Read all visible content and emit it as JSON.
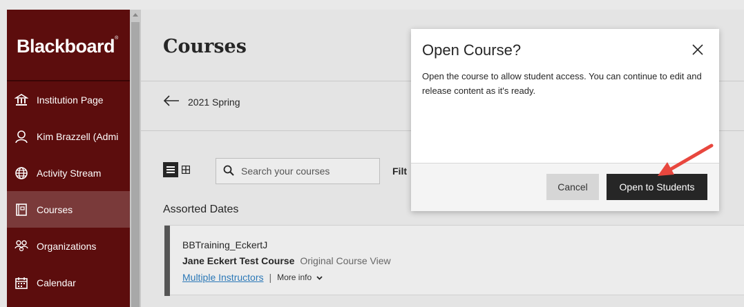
{
  "sidebar": {
    "logo": "Blackboard",
    "items": [
      {
        "label": "Institution Page",
        "icon": "bank-icon"
      },
      {
        "label": "Kim Brazzell (Admi",
        "icon": "user-icon"
      },
      {
        "label": "Activity Stream",
        "icon": "globe-icon"
      },
      {
        "label": "Courses",
        "icon": "book-icon",
        "active": true
      },
      {
        "label": "Organizations",
        "icon": "people-icon"
      },
      {
        "label": "Calendar",
        "icon": "calendar-icon"
      }
    ]
  },
  "main": {
    "title": "Courses",
    "breadcrumb": "2021 Spring",
    "search_placeholder": "Search your courses",
    "filter_label": "Filt",
    "section_heading": "Assorted Dates",
    "course": {
      "id": "BBTraining_EckertJ",
      "name": "Jane Eckert Test Course",
      "view": "Original Course View",
      "instructors_link": "Multiple Instructors",
      "separator": "|",
      "more_info": "More info"
    }
  },
  "modal": {
    "title": "Open Course?",
    "body": "Open the course to allow student access. You can continue to edit and release content as it's ready.",
    "cancel_label": "Cancel",
    "open_label": "Open to Students"
  },
  "colors": {
    "sidebar_bg": "#5c0d0d",
    "accent_link": "#2b78b7",
    "primary_button": "#262626",
    "annotation_arrow": "#e8473e"
  }
}
